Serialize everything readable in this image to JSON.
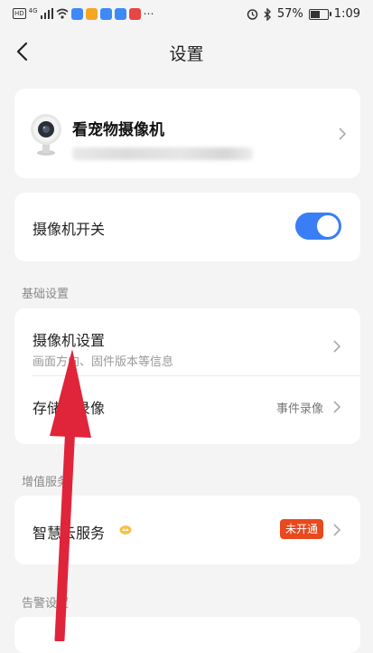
{
  "status_bar": {
    "network_left": "HD",
    "signal_label": "4G",
    "battery": "57%",
    "battery_level": 0.57,
    "time": "1:09"
  },
  "header": {
    "title": "设置"
  },
  "device": {
    "name": "看宠物摄像机"
  },
  "camera_switch": {
    "label": "摄像机开关",
    "on": true
  },
  "section_basic": {
    "label": "基础设置",
    "items": [
      {
        "label": "摄像机设置",
        "sub": "画面方向、固件版本等信息"
      },
      {
        "label": "存储与录像",
        "value": "事件录像"
      }
    ]
  },
  "section_value": {
    "label": "增值服务",
    "items": [
      {
        "label": "智慧云服务",
        "badge": "未开通"
      }
    ]
  },
  "section_alert": {
    "label": "告警设置"
  },
  "colors": {
    "accent": "#3a7ef5",
    "badge": "#e8491d",
    "annotation": "#e0243a"
  }
}
